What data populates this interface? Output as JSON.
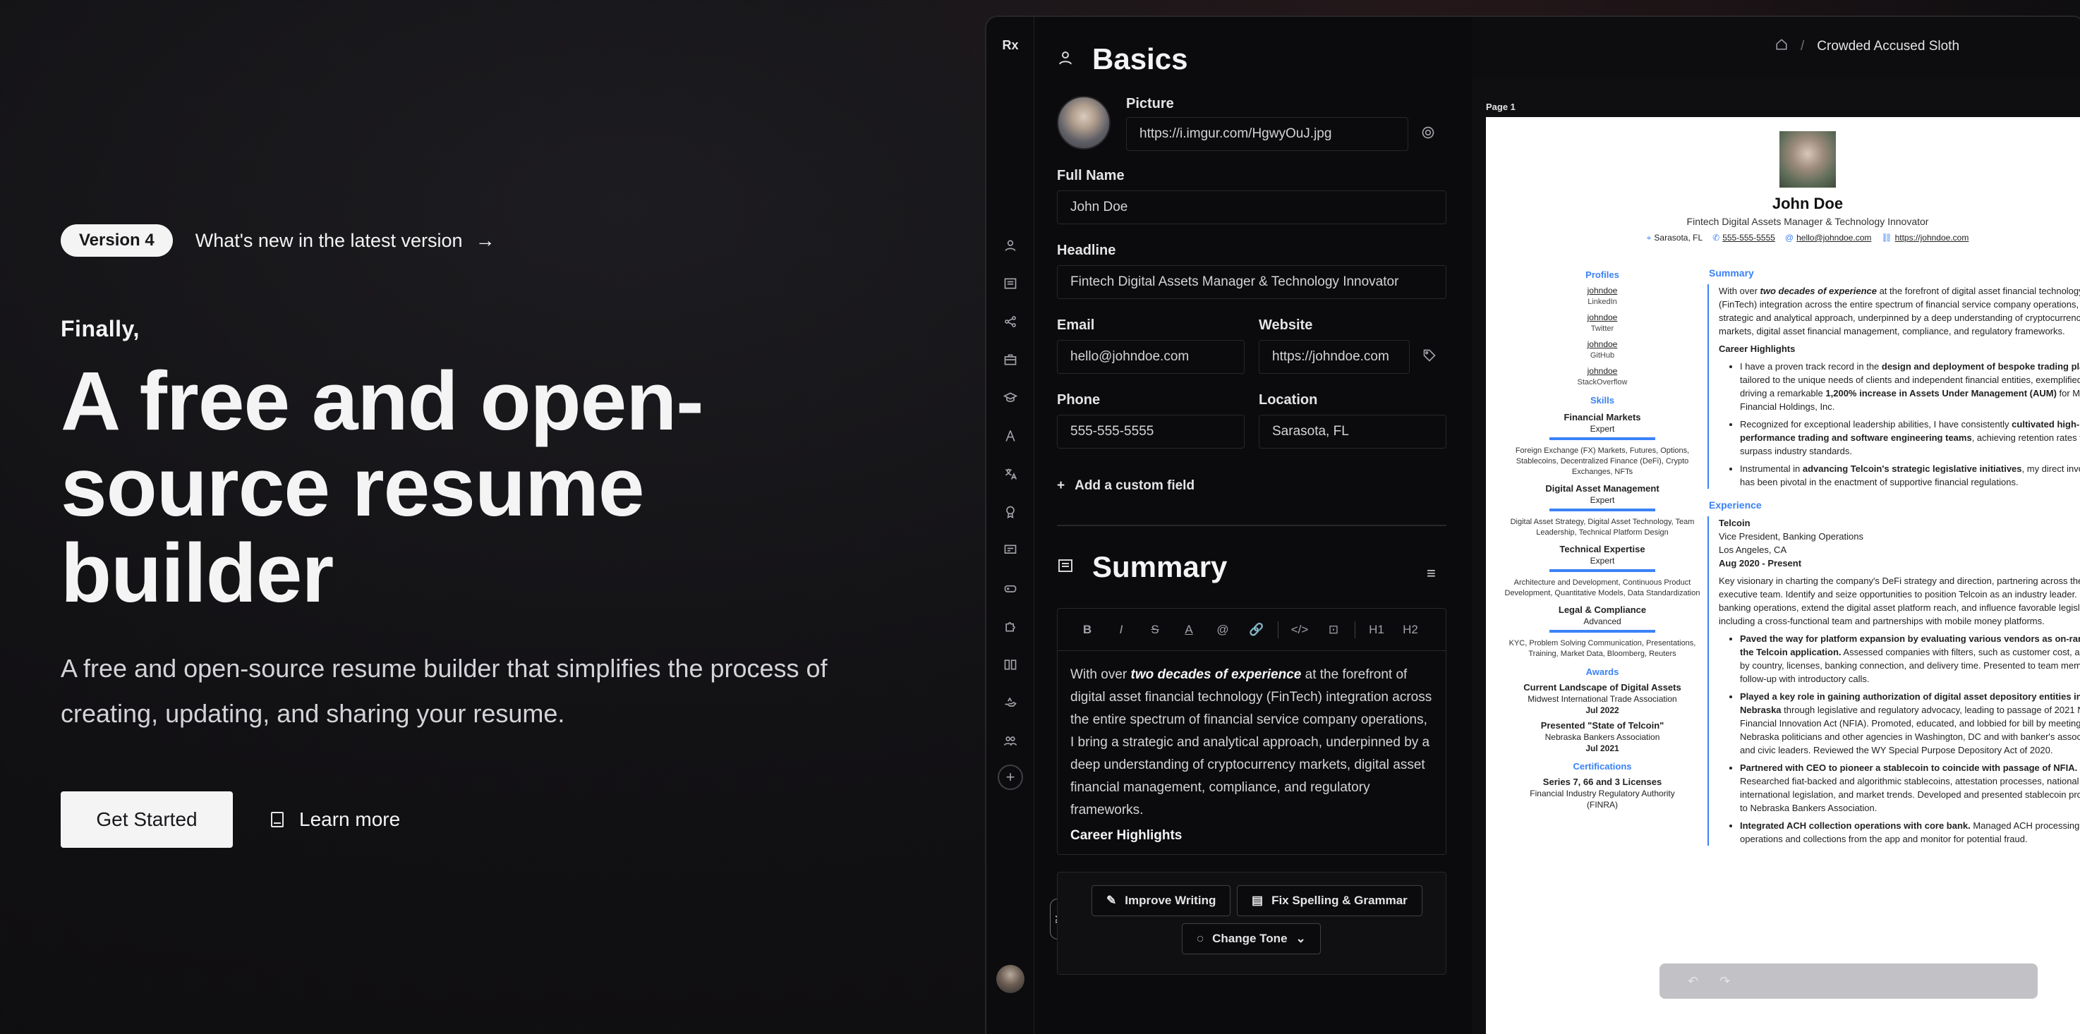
{
  "hero": {
    "version_badge": "Version 4",
    "whats_new": "What's new in the latest version",
    "eyebrow": "Finally,",
    "title": "A free and open-source resume builder",
    "subtitle": "A free and open-source resume builder that simplifies the process of creating, updating, and sharing your resume.",
    "get_started": "Get Started",
    "learn_more": "Learn more"
  },
  "app": {
    "logo": "Rx",
    "breadcrumb": {
      "separator": "/",
      "current": "Crowded Accused Sloth"
    },
    "basics": {
      "title": "Basics",
      "picture_label": "Picture",
      "picture_url": "https://i.imgur.com/HgwyOuJ.jpg",
      "full_name_label": "Full Name",
      "full_name": "John Doe",
      "headline_label": "Headline",
      "headline": "Fintech Digital Assets Manager & Technology Innovator",
      "email_label": "Email",
      "email": "hello@johndoe.com",
      "website_label": "Website",
      "website": "https://johndoe.com",
      "phone_label": "Phone",
      "phone": "555-555-5555",
      "location_label": "Location",
      "location": "Sarasota, FL",
      "add_custom": "Add a custom field"
    },
    "summary": {
      "title": "Summary",
      "toolbar": [
        "B",
        "I",
        "S",
        "A",
        "@",
        "🔗",
        "</>",
        "⊡",
        "H1",
        "H2"
      ],
      "text_intro": "With over ",
      "text_emph": "two decades of experience",
      "text_rest": " at the forefront of digital asset financial technology (FinTech) integration across the entire spectrum of financial service company operations, I bring a strategic and analytical approach, underpinned by a deep understanding of cryptocurrency markets, digital asset financial management, compliance, and regulatory frameworks.",
      "text_heading": "Career Highlights"
    },
    "ai": {
      "tag": "AI",
      "improve": "Improve Writing",
      "fix": "Fix Spelling & Grammar",
      "tone": "Change Tone"
    }
  },
  "resume": {
    "page_label": "Page 1",
    "name": "John Doe",
    "headline": "Fintech Digital Assets Manager & Technology Innovator",
    "contacts": [
      "Sarasota, FL",
      "555-555-5555",
      "hello@johndoe.com",
      "https://johndoe.com"
    ],
    "profiles_title": "Profiles",
    "profiles": [
      {
        "user": "johndoe",
        "network": "LinkedIn"
      },
      {
        "user": "johndoe",
        "network": "Twitter"
      },
      {
        "user": "johndoe",
        "network": "GitHub"
      },
      {
        "user": "johndoe",
        "network": "StackOverflow"
      }
    ],
    "skills_title": "Skills",
    "skills": [
      {
        "name": "Financial Markets",
        "level": "Expert",
        "keywords": "Foreign Exchange (FX) Markets, Futures, Options, Stablecoins, Decentralized Finance (DeFi), Crypto Exchanges, NFTs"
      },
      {
        "name": "Digital Asset Management",
        "level": "Expert",
        "keywords": "Digital Asset Strategy, Digital Asset Technology, Team Leadership, Technical Platform Design"
      },
      {
        "name": "Technical Expertise",
        "level": "Expert",
        "keywords": "Architecture and Development, Continuous Product Development, Quantitative Models, Data Standardization"
      },
      {
        "name": "Legal & Compliance",
        "level": "Advanced",
        "keywords": "KYC, Problem Solving Communication, Presentations, Training, Market Data, Bloomberg, Reuters"
      }
    ],
    "awards_title": "Awards",
    "awards": [
      {
        "title": "Current Landscape of Digital Assets",
        "org": "Midwest International Trade Association",
        "date": "Jul 2022"
      },
      {
        "title": "Presented \"State of Telcoin\"",
        "org": "Nebraska Bankers Association",
        "date": "Jul 2021"
      }
    ],
    "certs_title": "Certifications",
    "cert": {
      "title": "Series 7, 66 and 3 Licenses",
      "org": "Financial Industry Regulatory Authority",
      "org2": "(FINRA)"
    },
    "summary_title": "Summary",
    "summary_intro": "With over ",
    "summary_emph": "two decades of experience",
    "summary_rest": " at the forefront of digital asset financial technology (FinTech) integration across the entire spectrum of financial service company operations, I bring a strategic and analytical approach, underpinned by a deep understanding of cryptocurrency markets, digital asset financial management, compliance, and regulatory frameworks.",
    "highlights_title": "Career Highlights",
    "h1_a": "I have a proven track record in the ",
    "h1_b": "design and deployment of bespoke trading platforms",
    "h1_c": " tailored to the unique needs of clients and independent financial entities, exemplified by driving a remarkable ",
    "h1_d": "1,200% increase in Assets Under Management (AUM)",
    "h1_e": " for Mesirow Financial Holdings, Inc.",
    "h2_a": "Recognized for exceptional leadership abilities, I have consistently ",
    "h2_b": "cultivated high-performance trading and software engineering teams",
    "h2_c": ", achieving retention rates that surpass industry standards.",
    "h3_a": "Instrumental in ",
    "h3_b": "advancing Telcoin's strategic legislative initiatives",
    "h3_c": ", my direct involvement has been pivotal in the enactment of supportive financial regulations.",
    "experience_title": "Experience",
    "exp_company": "Telcoin",
    "exp_position": "Vice President, Banking Operations",
    "exp_location": "Los Angeles, CA",
    "exp_date": "Aug 2020 - Present",
    "exp_summary": "Key visionary in charting the company's DeFi strategy and direction, partnering across the executive team. Identify and seize opportunities to position Telcoin as an industry leader. Lead banking operations, extend the digital asset platform reach, and influence favorable legislation, including a cross-functional team and partnerships with mobile money platforms.",
    "e1_b": "Paved the way for platform expansion by evaluating various vendors as on-ramps for the Telcoin application.",
    "e1_c": " Assessed companies with filters, such as customer cost, availability by country, licenses, banking connection, and delivery time. Presented to team members for follow-up with introductory calls.",
    "e2_b": "Played a key role in gaining authorization of digital asset depository entities in Nebraska",
    "e2_c": " through legislative and regulatory advocacy, leading to passage of 2021 Nebraska Financial Innovation Act (NFIA). Promoted, educated, and lobbied for bill by meeting with Nebraska politicians and other agencies in Washington, DC and with banker's associations and civic leaders. Reviewed the WY Special Purpose Depository Act of 2020.",
    "e3_b": "Partnered with CEO to pioneer a stablecoin to coincide with passage of NFIA.",
    "e3_c": " Researched fiat-backed and algorithmic stablecoins, attestation processes, national and international legislation, and market trends. Developed and presented stablecoin proposals to Nebraska Bankers Association.",
    "e4_b": "Integrated ACH collection operations with core bank.",
    "e4_c": " Managed ACH processing operations and collections from the app and monitor for potential fraud."
  }
}
